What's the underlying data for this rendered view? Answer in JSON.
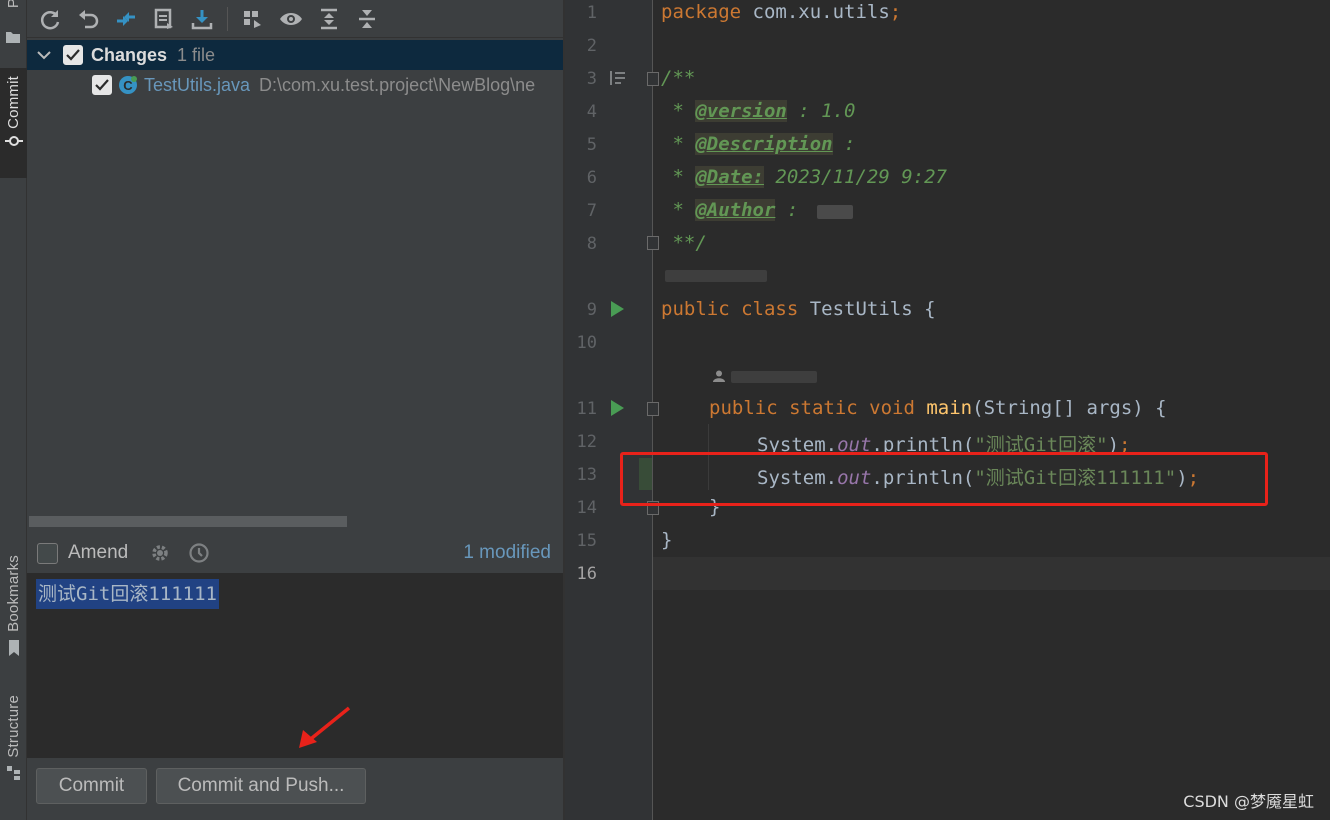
{
  "strip": {
    "project_label": "Project",
    "commit_label": "Commit",
    "bookmarks_label": "Bookmarks",
    "structure_label": "Structure"
  },
  "toolbar": {
    "icons": [
      "refresh-icon",
      "rollback-icon",
      "diff-icon",
      "changelist-icon",
      "update-icon",
      "group-by-icon",
      "preview-icon",
      "expand-all-icon",
      "collapse-all-icon"
    ]
  },
  "tree": {
    "group_label": "Changes",
    "group_count": "1 file",
    "file_name": "TestUtils.java",
    "file_path": "D:\\com.xu.test.project\\NewBlog\\ne"
  },
  "amend": {
    "label": "Amend",
    "modified": "1 modified"
  },
  "message": {
    "text": "测试Git回滚111111"
  },
  "buttons": {
    "commit": "Commit",
    "commit_push": "Commit and Push..."
  },
  "editor": {
    "line_numbers": [
      "1",
      "2",
      "3",
      "4",
      "5",
      "6",
      "7",
      "8",
      "9",
      "10",
      "11",
      "12",
      "13",
      "14",
      "15",
      "16"
    ],
    "package_kw": "package",
    "package_name": " com.xu.utils",
    "semicolon": ";",
    "doc_open": "/**",
    "doc_star": " * ",
    "version_tag": "@version",
    "version_val": " : 1.0",
    "description_tag": "@Description",
    "description_val": " :",
    "date_tag": "@Date:",
    "date_val": " 2023/11/29 9:27",
    "author_tag": "@Author",
    "author_val": " :",
    "doc_close": " **/",
    "public_kw": "public",
    "class_kw": " class",
    "class_name": " TestUtils {",
    "static_void": " static void",
    "main_fn": " main",
    "main_args": "(String[] args) {",
    "system": "System.",
    "out": "out",
    "println": ".println(",
    "str1": "\"测试Git回滚\"",
    "str2": "\"测试Git回滚111111\"",
    "close_paren": ")",
    "inner_close": "}",
    "outer_close": "}"
  },
  "watermark": "CSDN @梦魇星虹",
  "colors": {
    "annotation_red": "#e8221a",
    "run_green": "#499c54",
    "keyword": "#cc7832",
    "string": "#6a8759",
    "doc_comment": "#629755"
  }
}
